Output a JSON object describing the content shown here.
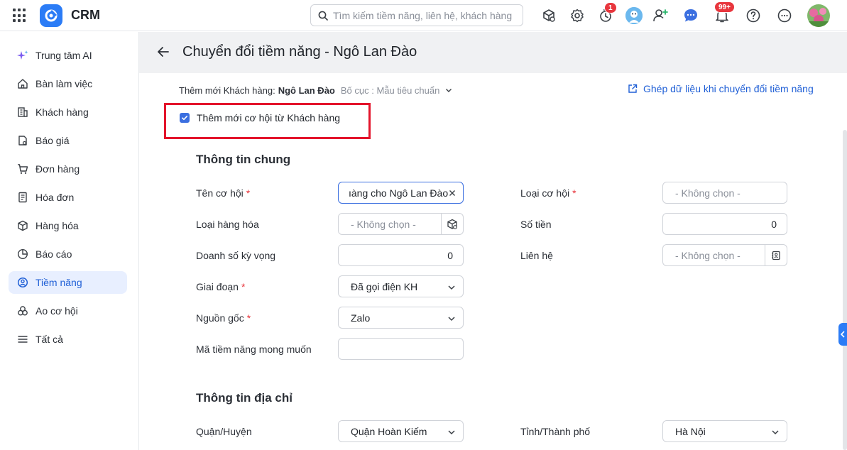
{
  "app": {
    "name": "CRM"
  },
  "search": {
    "placeholder": "Tìm kiếm tiềm năng, liên hệ, khách hàng"
  },
  "topbar": {
    "timer_badge": "1",
    "notification_badge": "99+"
  },
  "sidebar": {
    "items": [
      {
        "label": "Trung tâm AI",
        "icon": "sparkle-icon"
      },
      {
        "label": "Bàn làm việc",
        "icon": "home-icon"
      },
      {
        "label": "Khách hàng",
        "icon": "building-icon"
      },
      {
        "label": "Báo giá",
        "icon": "quote-icon"
      },
      {
        "label": "Đơn hàng",
        "icon": "cart-icon"
      },
      {
        "label": "Hóa đơn",
        "icon": "invoice-icon"
      },
      {
        "label": "Hàng hóa",
        "icon": "box-icon"
      },
      {
        "label": "Báo cáo",
        "icon": "pie-chart-icon"
      },
      {
        "label": "Tiềm năng",
        "icon": "lead-icon",
        "active": true
      },
      {
        "label": "Ao cơ hội",
        "icon": "pool-icon"
      },
      {
        "label": "Tất cả",
        "icon": "menu-icon"
      }
    ]
  },
  "header": {
    "title": "Chuyển đổi tiềm năng - Ngô Lan Đào"
  },
  "subheader": {
    "prefix": "Thêm mới Khách hàng:",
    "customer_name": "Ngô Lan Đào",
    "layout": "Bố cục : Mẫu tiêu chuẩn",
    "merge_link": "Ghép dữ liệu khi chuyển đổi tiềm năng"
  },
  "checkbox": {
    "label": "Thêm mới cơ hội từ Khách hàng",
    "checked": true
  },
  "sections": {
    "general": "Thông tin chung",
    "address": "Thông tin địa chỉ"
  },
  "form": {
    "opportunity_name": {
      "label": "Tên cơ hội",
      "value": "ıàng cho Ngô Lan Đào"
    },
    "product_type": {
      "label": "Loại hàng hóa",
      "placeholder": "- Không chọn -"
    },
    "expected_revenue": {
      "label": "Doanh số kỳ vọng",
      "value": "0"
    },
    "stage": {
      "label": "Giai đoạn",
      "value": "Đã gọi điện KH"
    },
    "source": {
      "label": "Nguồn gốc",
      "value": "Zalo"
    },
    "desired_lead_code": {
      "label": "Mã tiềm năng mong muốn",
      "value": ""
    },
    "opportunity_type": {
      "label": "Loại cơ hội",
      "placeholder": "- Không chọn -"
    },
    "amount": {
      "label": "Số tiền",
      "value": "0"
    },
    "contact": {
      "label": "Liên hệ",
      "placeholder": "- Không chọn -"
    },
    "district": {
      "label": "Quận/Huyện",
      "value": "Quận Hoàn Kiếm"
    },
    "province": {
      "label": "Tỉnh/Thành phố",
      "value": "Hà Nội"
    }
  },
  "required_mark": "*",
  "colors": {
    "accent": "#2b7cf6",
    "active_bg": "#e8efff",
    "required": "#e8363d",
    "highlight_box": "#e3142b"
  }
}
